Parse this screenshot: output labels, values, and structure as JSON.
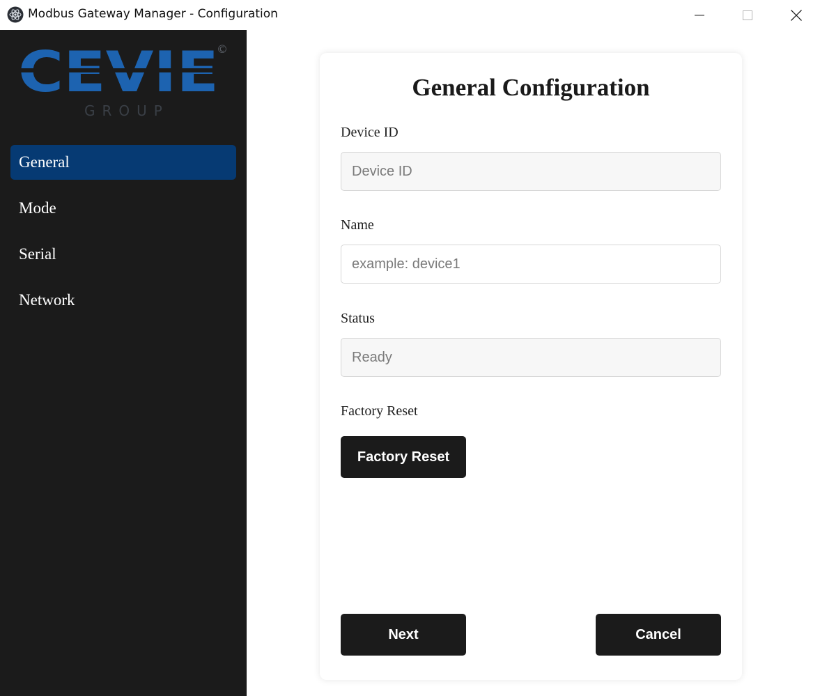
{
  "window": {
    "title": "Modbus Gateway Manager - Configuration",
    "controls": [
      "minimize-icon",
      "maximize-icon",
      "close-icon"
    ]
  },
  "sidebar": {
    "logo": {
      "brand": "CEVIE",
      "subtitle": "GROUP",
      "mark": "©"
    },
    "items": [
      {
        "label": "General",
        "active": true
      },
      {
        "label": "Mode",
        "active": false
      },
      {
        "label": "Serial",
        "active": false
      },
      {
        "label": "Network",
        "active": false
      }
    ]
  },
  "main": {
    "title": "General Configuration",
    "fields": [
      {
        "label": "Device ID",
        "value": "",
        "placeholder": "Device ID"
      },
      {
        "label": "Name",
        "value": "",
        "placeholder": "example: device1"
      },
      {
        "label": "Status",
        "value": "",
        "placeholder": "Ready"
      }
    ],
    "factory_reset": {
      "label": "Factory Reset",
      "button": "Factory Reset"
    },
    "buttons": {
      "next": "Next",
      "cancel": "Cancel"
    }
  },
  "colors": {
    "sidebar_bg": "#1b1b1b",
    "active_item": "#063a73",
    "logo_blue": "#1d63b0",
    "button_bg": "#1b1b1b"
  }
}
